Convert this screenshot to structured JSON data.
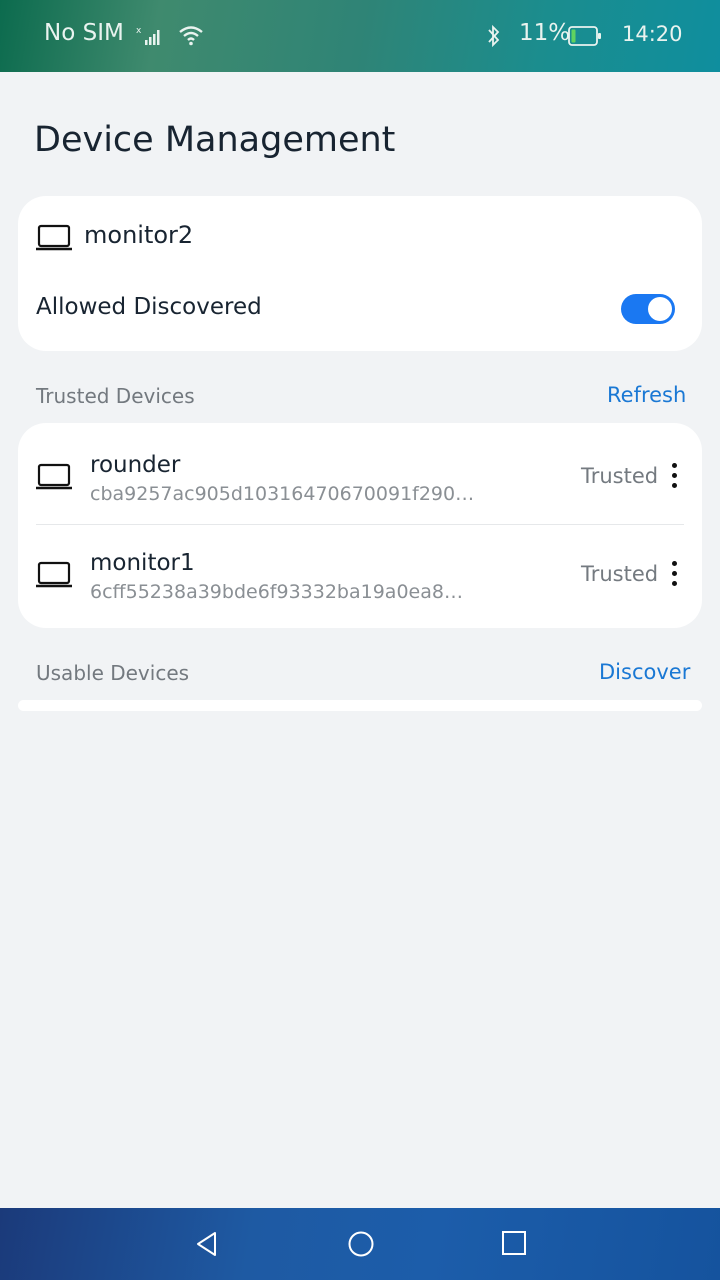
{
  "status_bar": {
    "carrier": "No SIM",
    "battery_percent": "11%",
    "time": "14:20",
    "icons": [
      "signal-icon",
      "wifi-icon",
      "bluetooth-icon",
      "battery-icon"
    ]
  },
  "page": {
    "title": "Device Management"
  },
  "local_device": {
    "icon": "laptop-icon",
    "name": "monitor2",
    "allowed_label": "Allowed Discovered",
    "allowed_on": true
  },
  "trusted_section": {
    "label": "Trusted Devices",
    "action": "Refresh",
    "devices": [
      {
        "icon": "laptop-icon",
        "name": "rounder",
        "id": "cba9257ac905d10316470670091f290…",
        "status": "Trusted"
      },
      {
        "icon": "laptop-icon",
        "name": "monitor1",
        "id": "6cff55238a39bde6f93332ba19a0ea8…",
        "status": "Trusted"
      }
    ]
  },
  "usable_section": {
    "label": "Usable Devices",
    "action": "Discover"
  },
  "nav_bar": {
    "icons": [
      "back-icon",
      "home-icon",
      "recent-apps-icon"
    ]
  },
  "colors": {
    "accent": "#1a78f2",
    "background": "#f1f3f5",
    "card": "#ffffff"
  }
}
